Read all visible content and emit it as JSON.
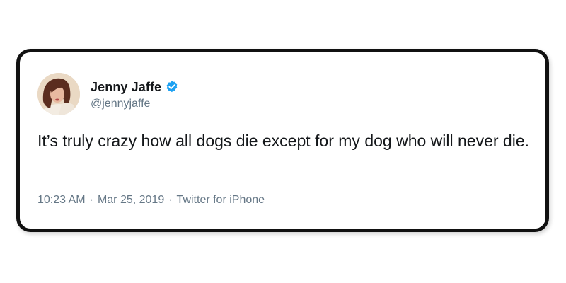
{
  "tweet": {
    "author": {
      "display_name": "Jenny Jaffe",
      "handle": "@jennyjaffe",
      "verified": true,
      "avatar_icon": "profile-photo"
    },
    "text": "It’s truly crazy how all dogs die except for my dog who will never die.",
    "time": "10:23 AM",
    "date": "Mar 25, 2019",
    "source": "Twitter for iPhone",
    "separator": "·"
  },
  "colors": {
    "text_primary": "#14171a",
    "text_secondary": "#657786",
    "verified_blue": "#1da1f2",
    "card_border": "#111111"
  }
}
